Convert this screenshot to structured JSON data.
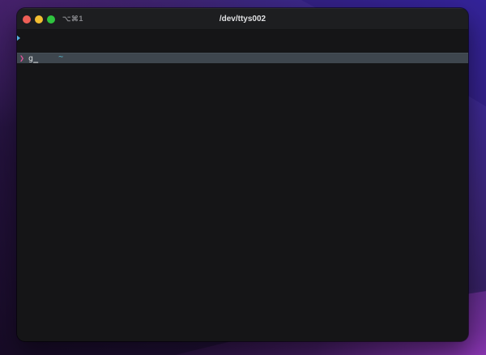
{
  "window": {
    "title": "/dev/ttys002",
    "shortcut_label": "⌥⌘1",
    "traffic_lights": [
      "close",
      "minimize",
      "zoom"
    ]
  },
  "terminal": {
    "mark_icon": "shell-prompt-mark-triangle",
    "directory": "~",
    "prompt_char": "❯",
    "typed_command": "g",
    "cursor": "_"
  },
  "colors": {
    "titlebar_bg": "#1d1e20",
    "terminal_bg": "#151517",
    "highlight_row_bg": "#3e464e",
    "prompt_pink": "#e0569a",
    "directory_cyan": "#55b8cc",
    "mark_blue": "#53aee0",
    "traffic_red": "#ee5f57",
    "traffic_yellow": "#f2be32",
    "traffic_green": "#2fc43f",
    "title_text": "#dfe0e2",
    "shortcut_text": "#85868a",
    "command_text": "#d8dadc",
    "cursor_color": "#eceef0"
  }
}
